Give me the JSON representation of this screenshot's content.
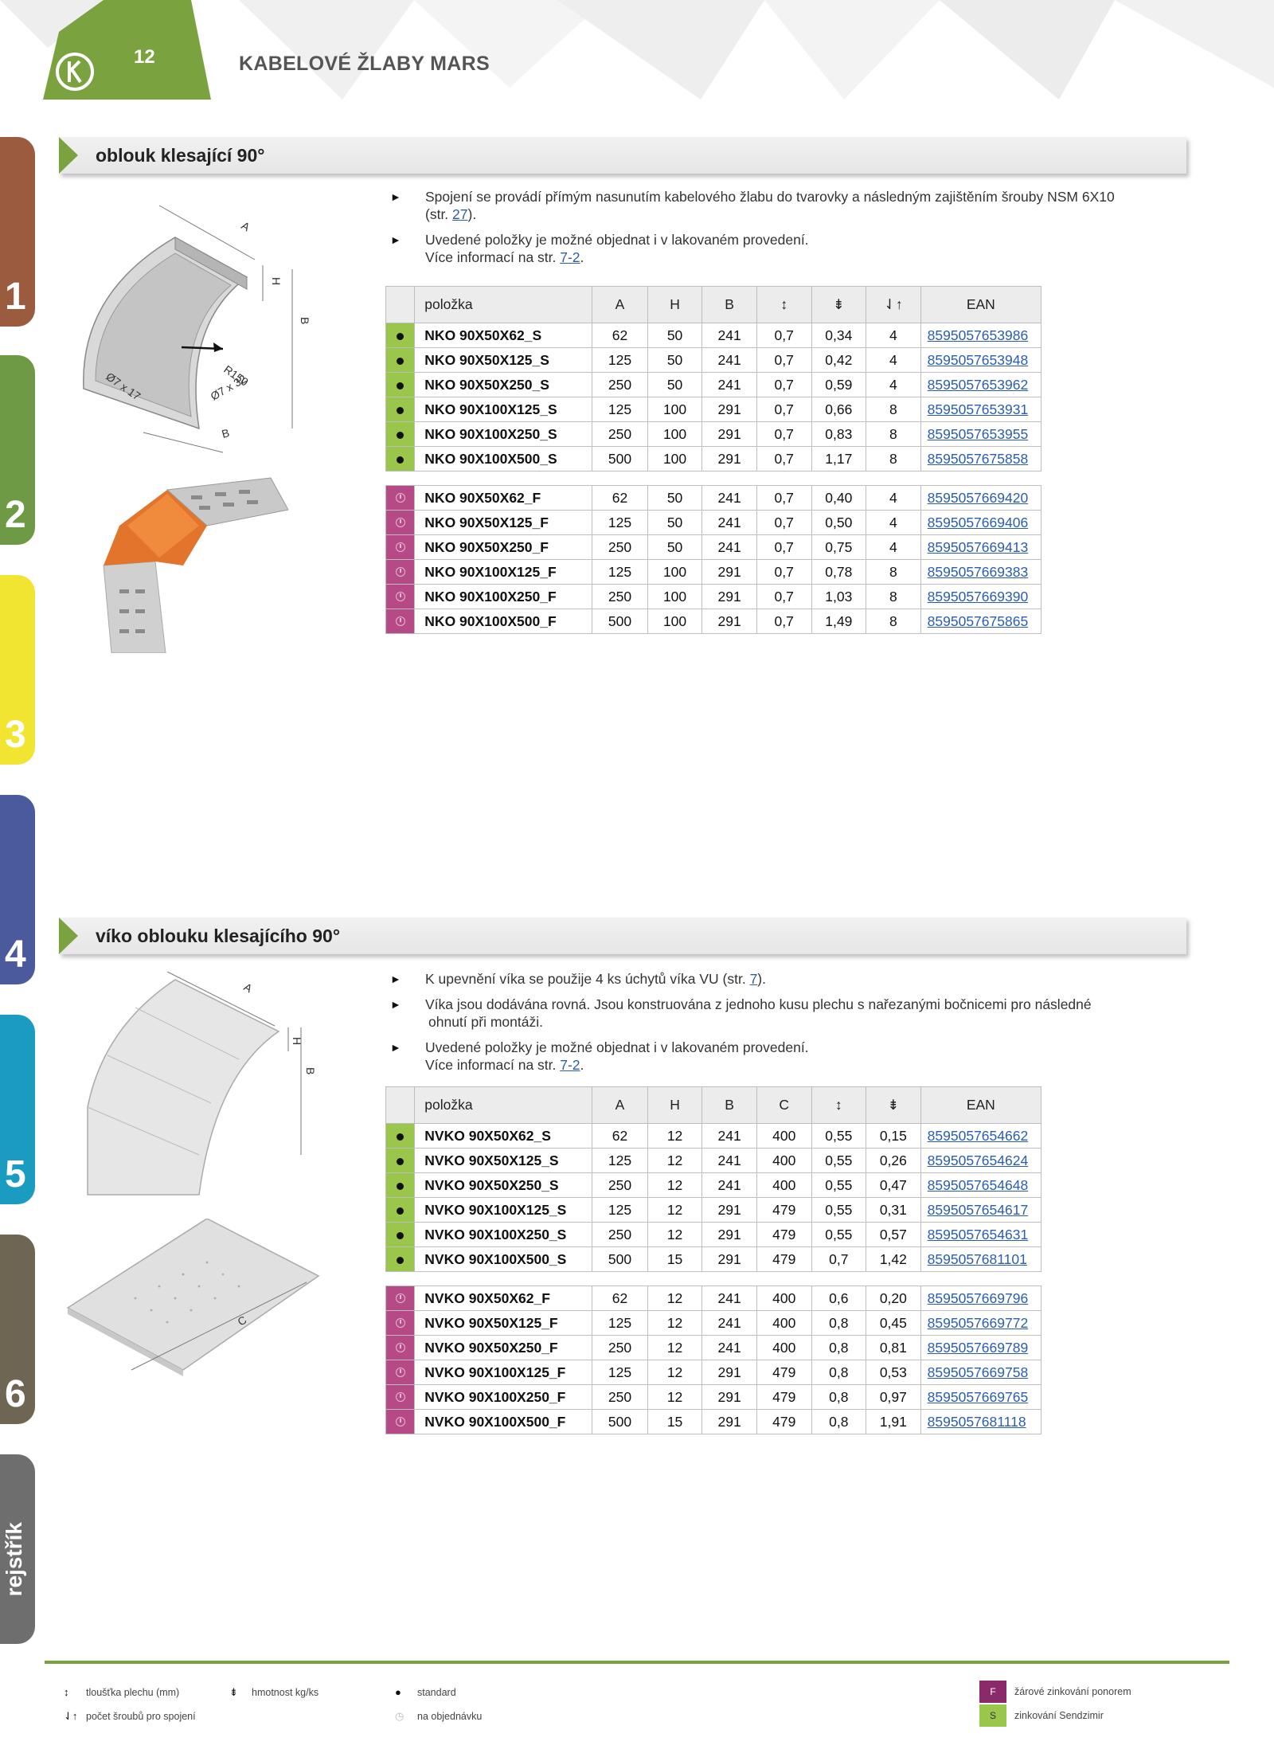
{
  "header": {
    "page_number": "12",
    "title": "KABELOVÉ ŽLABY MARS"
  },
  "side_tabs": [
    "1",
    "2",
    "3",
    "4",
    "5",
    "6",
    "rejstřík"
  ],
  "section1": {
    "title": "oblouk klesající 90°",
    "bullet1_text": "Spojení se provádí přímým nasunutím kabelového žlabu do tvarovky a následným zajištěním šrouby NSM 6X10",
    "bullet1_line2_pre": "(str. ",
    "bullet1_link": "27",
    "bullet1_line2_post": ").",
    "bullet2_text": "Uvedené položky je možné objednat i v lakovaném provedení.",
    "bullet2_line2_pre": "Více informací na str. ",
    "bullet2_link": "7-2",
    "bullet2_line2_post": ".",
    "drawing_labels": {
      "a": "A",
      "h": "H",
      "b_side": "B",
      "b_bottom": "B",
      "r": "R150",
      "hole1": "Ø7 x 17",
      "hole2": "Ø7 x 32"
    },
    "table": {
      "headers": [
        "položka",
        "A",
        "H",
        "B",
        "↕",
        "⇟",
        "⇃↑",
        "EAN"
      ],
      "rows_s": [
        [
          "NKO 90X50X62_S",
          "62",
          "50",
          "241",
          "0,7",
          "0,34",
          "4",
          "8595057653986"
        ],
        [
          "NKO 90X50X125_S",
          "125",
          "50",
          "241",
          "0,7",
          "0,42",
          "4",
          "8595057653948"
        ],
        [
          "NKO 90X50X250_S",
          "250",
          "50",
          "241",
          "0,7",
          "0,59",
          "4",
          "8595057653962"
        ],
        [
          "NKO 90X100X125_S",
          "125",
          "100",
          "291",
          "0,7",
          "0,66",
          "8",
          "8595057653931"
        ],
        [
          "NKO 90X100X250_S",
          "250",
          "100",
          "291",
          "0,7",
          "0,83",
          "8",
          "8595057653955"
        ],
        [
          "NKO 90X100X500_S",
          "500",
          "100",
          "291",
          "0,7",
          "1,17",
          "8",
          "8595057675858"
        ]
      ],
      "rows_f": [
        [
          "NKO 90X50X62_F",
          "62",
          "50",
          "241",
          "0,7",
          "0,40",
          "4",
          "8595057669420"
        ],
        [
          "NKO 90X50X125_F",
          "125",
          "50",
          "241",
          "0,7",
          "0,50",
          "4",
          "8595057669406"
        ],
        [
          "NKO 90X50X250_F",
          "250",
          "50",
          "241",
          "0,7",
          "0,75",
          "4",
          "8595057669413"
        ],
        [
          "NKO 90X100X125_F",
          "125",
          "100",
          "291",
          "0,7",
          "0,78",
          "8",
          "8595057669383"
        ],
        [
          "NKO 90X100X250_F",
          "250",
          "100",
          "291",
          "0,7",
          "1,03",
          "8",
          "8595057669390"
        ],
        [
          "NKO 90X100X500_F",
          "500",
          "100",
          "291",
          "0,7",
          "1,49",
          "8",
          "8595057675865"
        ]
      ]
    }
  },
  "section2": {
    "title": "víko oblouku klesajícího 90°",
    "bullet1_pre": "K upevnění víka se použije 4 ks úchytů víka VU (str. ",
    "bullet1_link": "7",
    "bullet1_post": ").",
    "bullet2_text": "Víka jsou dodávána rovná. Jsou konstruována z jednoho kusu plechu s nařezanými bočnicemi pro následné",
    "bullet2_line2": "ohnutí při montáži.",
    "bullet3_text": "Uvedené položky je možné objednat i v lakovaném provedení.",
    "bullet3_line2_pre": "Více informací na str. ",
    "bullet3_link": "7-2",
    "bullet3_line2_post": ".",
    "drawing_labels": {
      "a": "A",
      "h": "H",
      "b": "B",
      "c": "C"
    },
    "table": {
      "headers": [
        "položka",
        "A",
        "H",
        "B",
        "C",
        "↕",
        "⇟",
        "EAN"
      ],
      "rows_s": [
        [
          "NVKO 90X50X62_S",
          "62",
          "12",
          "241",
          "400",
          "0,55",
          "0,15",
          "8595057654662"
        ],
        [
          "NVKO 90X50X125_S",
          "125",
          "12",
          "241",
          "400",
          "0,55",
          "0,26",
          "8595057654624"
        ],
        [
          "NVKO 90X50X250_S",
          "250",
          "12",
          "241",
          "400",
          "0,55",
          "0,47",
          "8595057654648"
        ],
        [
          "NVKO 90X100X125_S",
          "125",
          "12",
          "291",
          "479",
          "0,55",
          "0,31",
          "8595057654617"
        ],
        [
          "NVKO 90X100X250_S",
          "250",
          "12",
          "291",
          "479",
          "0,55",
          "0,57",
          "8595057654631"
        ],
        [
          "NVKO 90X100X500_S",
          "500",
          "15",
          "291",
          "479",
          "0,7",
          "1,42",
          "8595057681101"
        ]
      ],
      "rows_f": [
        [
          "NVKO 90X50X62_F",
          "62",
          "12",
          "241",
          "400",
          "0,6",
          "0,20",
          "8595057669796"
        ],
        [
          "NVKO 90X50X125_F",
          "125",
          "12",
          "241",
          "400",
          "0,8",
          "0,45",
          "8595057669772"
        ],
        [
          "NVKO 90X50X250_F",
          "250",
          "12",
          "241",
          "400",
          "0,8",
          "0,81",
          "8595057669789"
        ],
        [
          "NVKO 90X100X125_F",
          "125",
          "12",
          "291",
          "479",
          "0,8",
          "0,53",
          "8595057669758"
        ],
        [
          "NVKO 90X100X250_F",
          "250",
          "12",
          "291",
          "479",
          "0,8",
          "0,97",
          "8595057669765"
        ],
        [
          "NVKO 90X100X500_F",
          "500",
          "15",
          "291",
          "479",
          "0,8",
          "1,91",
          "8595057681118"
        ]
      ]
    }
  },
  "footer": {
    "thickness_label": "tloušťka plechu (mm)",
    "weight_label": "hmotnost kg/ks",
    "screws_label": "počet šroubů pro spojení",
    "standard_label": "standard",
    "order_label": "na objednávku",
    "f_code": "F",
    "f_label": "žárové zinkování ponorem",
    "s_code": "S",
    "s_label": "zinkování Sendzimir"
  },
  "colors": {
    "accent_green": "#7aa23f",
    "s_marker": "#9bc64c",
    "f_marker": "#b54a86",
    "tab1": "#9a5b3f",
    "tab2": "#6f9a45",
    "tab3": "#f2e531",
    "tab4": "#4b5a9c",
    "tab5": "#1a9cc0",
    "tab6": "#6e6553",
    "tab_reg": "#6e6e6e"
  }
}
